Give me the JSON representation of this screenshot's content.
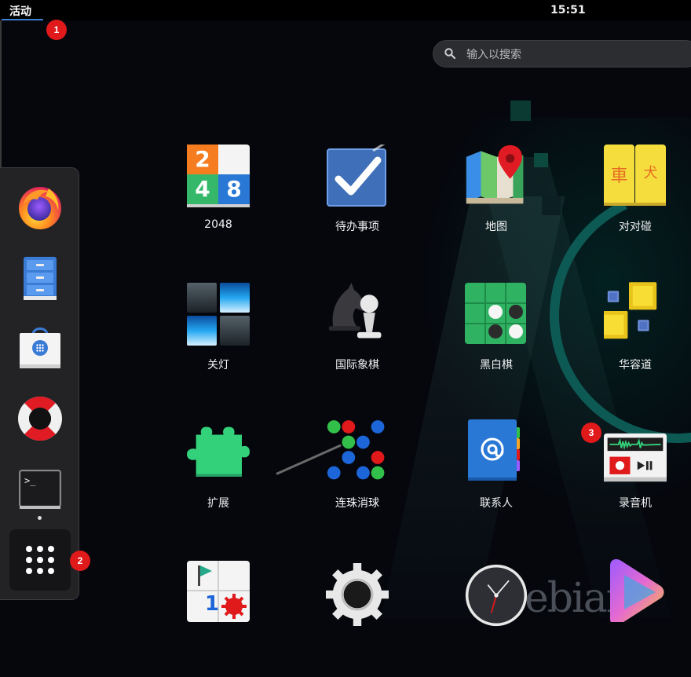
{
  "topbar": {
    "activities": "活动",
    "clock": "15:51"
  },
  "search": {
    "placeholder": "输入以搜索"
  },
  "dash": {
    "items": [
      {
        "name": "firefox"
      },
      {
        "name": "files"
      },
      {
        "name": "software"
      },
      {
        "name": "help"
      },
      {
        "name": "terminal"
      },
      {
        "name": "show-apps"
      }
    ]
  },
  "apps": [
    {
      "label": "2048"
    },
    {
      "label": "待办事项"
    },
    {
      "label": "地图"
    },
    {
      "label": "对对碰"
    },
    {
      "label": "关灯"
    },
    {
      "label": "国际象棋"
    },
    {
      "label": "黑白棋"
    },
    {
      "label": "华容道"
    },
    {
      "label": "扩展"
    },
    {
      "label": "连珠消球"
    },
    {
      "label": "联系人"
    },
    {
      "label": "录音机"
    }
  ],
  "tiles_2048": [
    "2",
    "4",
    "8"
  ],
  "tiles_1s": [
    "車",
    "犬"
  ],
  "mine_number": "1",
  "markers": [
    "1",
    "2",
    "3"
  ]
}
